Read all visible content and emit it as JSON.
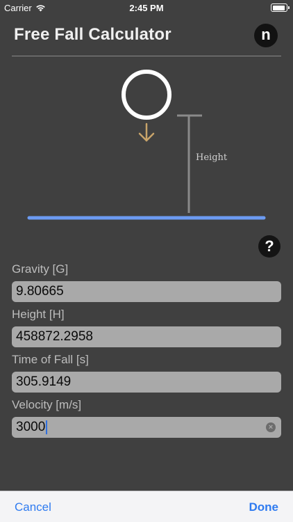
{
  "status_bar": {
    "carrier": "Carrier",
    "time": "2:45 PM"
  },
  "header": {
    "title": "Free Fall Calculator",
    "brand_letter": "n"
  },
  "diagram": {
    "height_label": "Height"
  },
  "help": {
    "symbol": "?"
  },
  "fields": [
    {
      "label": "Gravity [G]",
      "value": "9.80665"
    },
    {
      "label": "Height [H]",
      "value": "458872.2958"
    },
    {
      "label": "Time of Fall [s]",
      "value": "305.9149"
    },
    {
      "label": "Velocity [m/s]",
      "value": "3000"
    }
  ],
  "toolbar": {
    "cancel_label": "Cancel",
    "done_label": "Done"
  },
  "colors": {
    "background": "#404040",
    "input": "#a9a9a9",
    "ground": "#6c9bf2",
    "arrow": "#c8a46a",
    "accent": "#2f7bf0"
  }
}
